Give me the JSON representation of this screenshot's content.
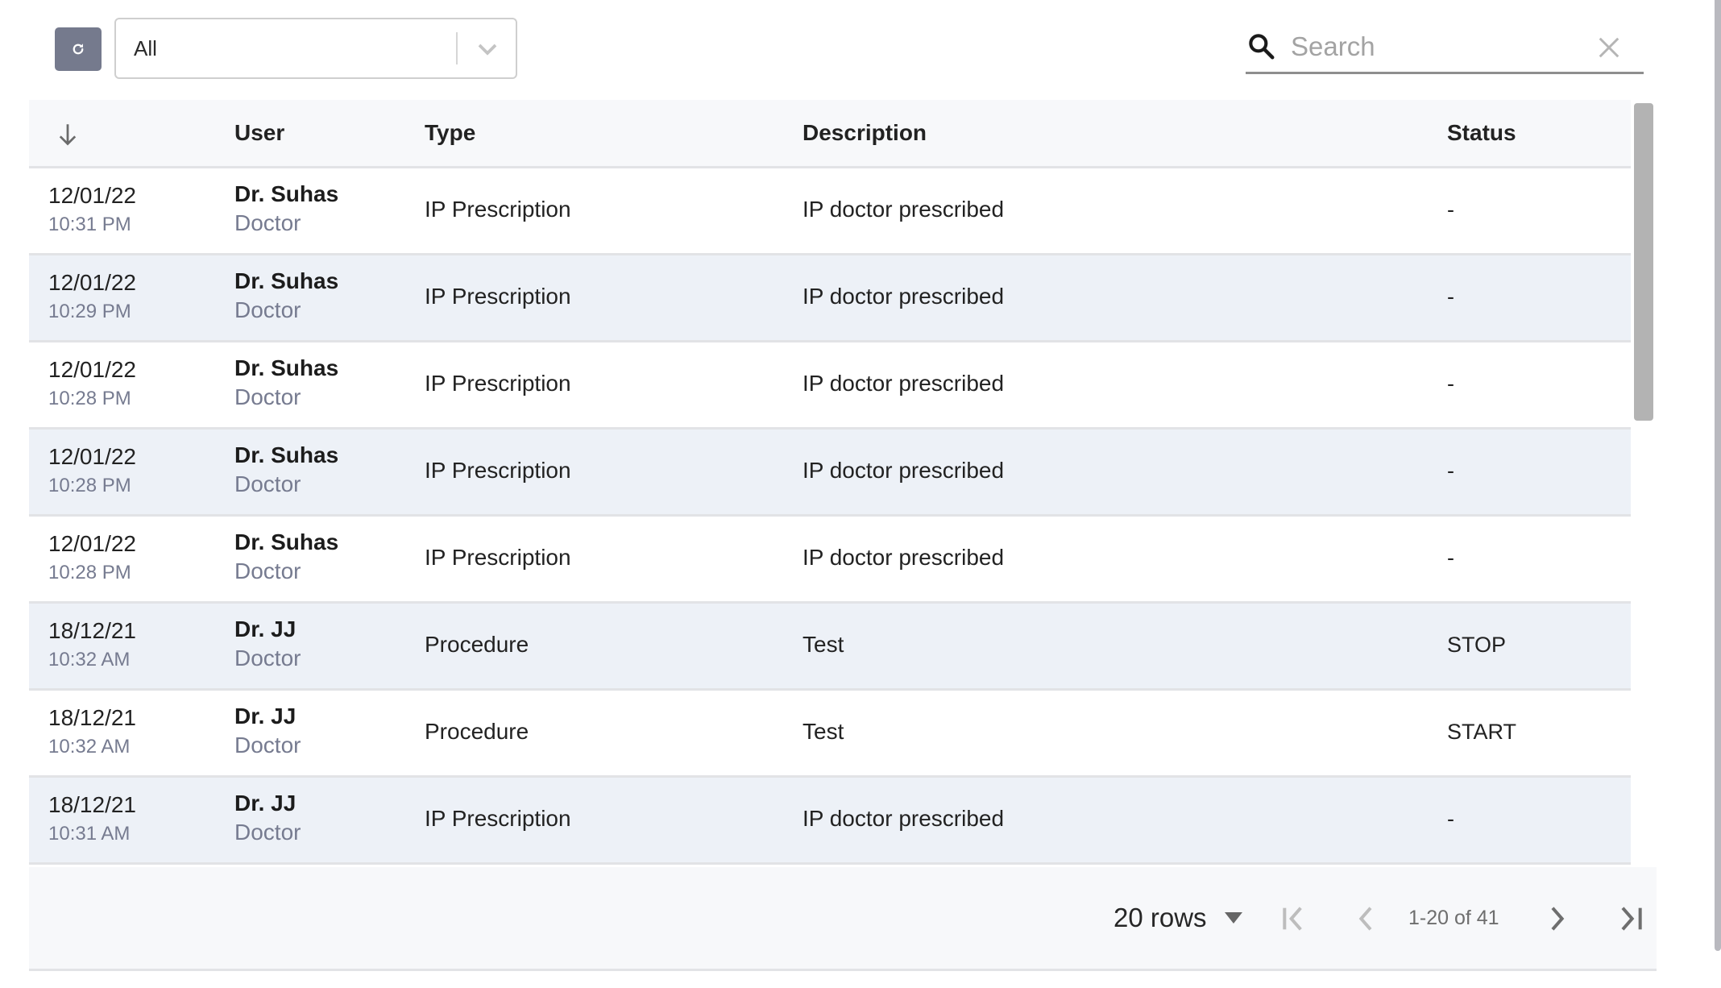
{
  "toolbar": {
    "refresh_icon": "refresh-icon",
    "filter_select": {
      "value": "All",
      "icon": "chevron-down-icon"
    },
    "search": {
      "placeholder": "Search",
      "value": "",
      "search_icon": "search-icon",
      "clear_icon": "close-icon"
    }
  },
  "table": {
    "columns": [
      {
        "key": "datetime",
        "label": "",
        "icon": "arrow-down-icon"
      },
      {
        "key": "user",
        "label": "User"
      },
      {
        "key": "type",
        "label": "Type"
      },
      {
        "key": "description",
        "label": "Description"
      },
      {
        "key": "status",
        "label": "Status"
      }
    ],
    "rows": [
      {
        "date": "12/01/22",
        "time": "10:31 PM",
        "user": "Dr. Suhas",
        "role": "Doctor",
        "type": "IP Prescription",
        "description": "IP doctor prescribed",
        "status": "-"
      },
      {
        "date": "12/01/22",
        "time": "10:29 PM",
        "user": "Dr. Suhas",
        "role": "Doctor",
        "type": "IP Prescription",
        "description": "IP doctor prescribed",
        "status": "-"
      },
      {
        "date": "12/01/22",
        "time": "10:28 PM",
        "user": "Dr. Suhas",
        "role": "Doctor",
        "type": "IP Prescription",
        "description": "IP doctor prescribed",
        "status": "-"
      },
      {
        "date": "12/01/22",
        "time": "10:28 PM",
        "user": "Dr. Suhas",
        "role": "Doctor",
        "type": "IP Prescription",
        "description": "IP doctor prescribed",
        "status": "-"
      },
      {
        "date": "12/01/22",
        "time": "10:28 PM",
        "user": "Dr. Suhas",
        "role": "Doctor",
        "type": "IP Prescription",
        "description": "IP doctor prescribed",
        "status": "-"
      },
      {
        "date": "18/12/21",
        "time": "10:32 AM",
        "user": "Dr. JJ",
        "role": "Doctor",
        "type": "Procedure",
        "description": "Test",
        "status": "STOP"
      },
      {
        "date": "18/12/21",
        "time": "10:32 AM",
        "user": "Dr. JJ",
        "role": "Doctor",
        "type": "Procedure",
        "description": "Test",
        "status": "START"
      },
      {
        "date": "18/12/21",
        "time": "10:31 AM",
        "user": "Dr. JJ",
        "role": "Doctor",
        "type": "IP Prescription",
        "description": "IP doctor prescribed",
        "status": "-"
      }
    ]
  },
  "pagination": {
    "rows_per_page": "20 rows",
    "range": "1-20 of 41",
    "first_icon": "first-page-icon",
    "prev_icon": "chevron-left-icon",
    "next_icon": "chevron-right-icon",
    "last_icon": "last-page-icon"
  },
  "colors": {
    "refresh_button": "#757a8d",
    "row_alt": "#edf1f7",
    "header_bg": "#f7f8fa",
    "secondary_text": "#767b90"
  }
}
